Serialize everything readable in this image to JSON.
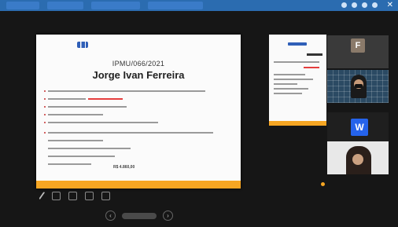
{
  "presentation": {
    "code": "IPMU/066/2021",
    "person_name": "Jorge Ivan Ferreira",
    "value": "R$ 4.860,00"
  },
  "participants": [
    {
      "initial": "F"
    },
    {
      "initial": "W"
    }
  ],
  "colors": {
    "accent": "#f6a623",
    "taskbar": "#2b6cb0",
    "highlight": "#e53e3e",
    "stage_bg": "#161616"
  },
  "icons": [
    "pen-icon",
    "copy-icon",
    "zoom-icon",
    "settings-icon",
    "fullscreen-icon",
    "chevron-left-icon",
    "chevron-right-icon",
    "close-icon"
  ]
}
